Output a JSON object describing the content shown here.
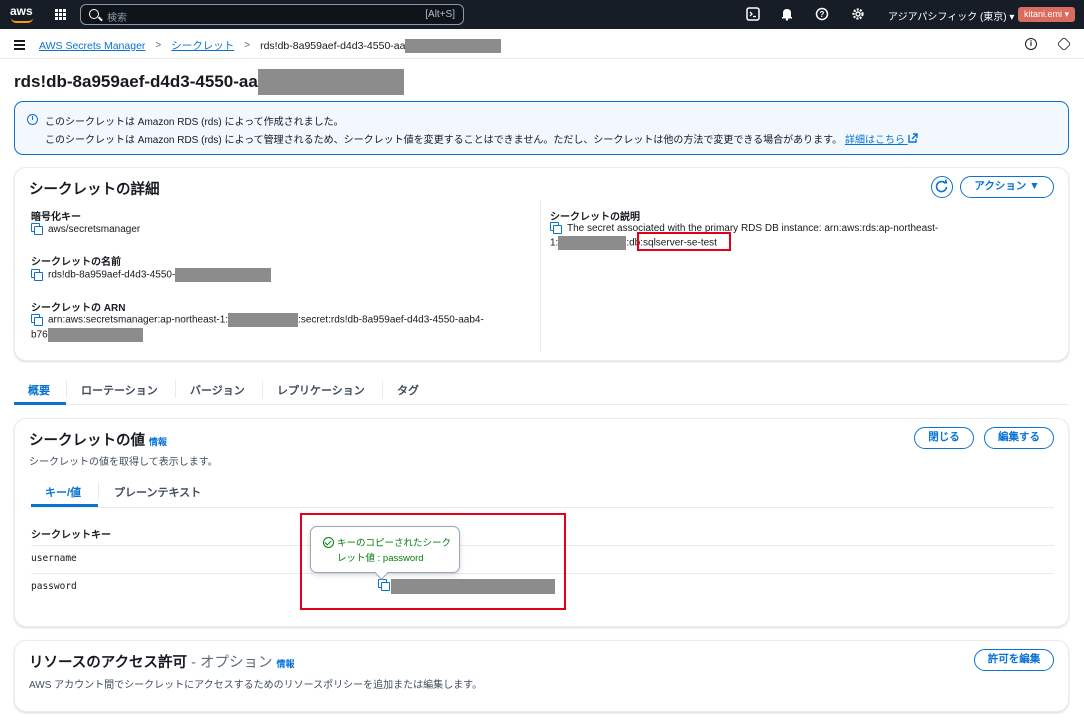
{
  "topnav": {
    "logo": "aws",
    "search_placeholder": "検索",
    "search_shortcut": "[Alt+S]",
    "region": "アジアパシフィック (東京) ▾",
    "user": "kitani.emi ▾",
    "icons": [
      "cloudshell-icon",
      "bell-icon",
      "help-icon",
      "settings-icon"
    ]
  },
  "breadcrumb": {
    "items": [
      "AWS Secrets Manager",
      "シークレット"
    ],
    "current": "rds!db-8a959aef-d4d3-4550-aa"
  },
  "page": {
    "title": "rds!db-8a959aef-d4d3-4550-aa"
  },
  "flash": {
    "line1": "このシークレットは Amazon RDS (rds) によって作成されました。",
    "line2": "このシークレットは Amazon RDS (rds) によって管理されるため、シークレット値を変更することはできません。ただし、シークレットは他の方法で変更できる場合があります。",
    "link": "詳細はこちら"
  },
  "details": {
    "title": "シークレットの詳細",
    "action_button": "アクション ▼",
    "encryption_key_label": "暗号化キー",
    "encryption_key_value": "aws/secretsmanager",
    "name_label": "シークレットの名前",
    "name_value": "rds!db-8a959aef-d4d3-4550-",
    "arn_label": "シークレットの ARN",
    "arn_part1": "arn:aws:secretsmanager:ap-northeast-1:",
    "arn_part2": ":secret:rds!db-8a959aef-d4d3-4550-aab4-",
    "arn_part3": "b76",
    "description_label": "シークレットの説明",
    "description_line1": "The secret associated with the primary RDS DB instance: arn:aws:rds:ap-northeast-",
    "description_prefix": "1:",
    "description_mid": ":db",
    "description_highlight": ":sqlserver-se-test"
  },
  "tabs": {
    "items": [
      "概要",
      "ローテーション",
      "バージョン",
      "レプリケーション",
      "タグ"
    ],
    "active": "概要"
  },
  "secret_value": {
    "title": "シークレットの値",
    "info": "情報",
    "subtitle": "シークレットの値を取得して表示します。",
    "close_button": "閉じる",
    "edit_button": "編集する",
    "subtabs": [
      "キー/値",
      "プレーンテキスト"
    ],
    "column_header": "シークレットキー",
    "rows": [
      "username",
      "password"
    ],
    "popover_text": "キーのコピーされたシークレット値 : password"
  },
  "resource_access": {
    "title": "リソースのアクセス許可",
    "optional": "- オプション",
    "info": "情報",
    "description": "AWS アカウント間でシークレットにアクセスするためのリソースポリシーを追加または編集します。",
    "edit_button": "許可を編集"
  }
}
